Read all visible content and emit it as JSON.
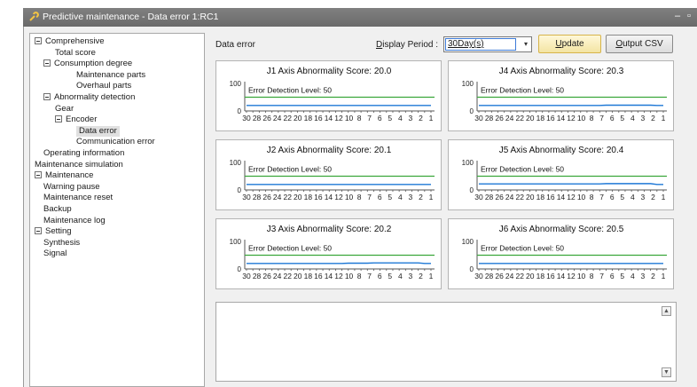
{
  "window": {
    "title": "Predictive maintenance - Data error 1:RC1",
    "app_icon": "wrench-icon",
    "minimize_glyph": "–",
    "restore_glyph": "▫"
  },
  "tree": {
    "items": [
      {
        "label": "Comprehensive",
        "level": 0,
        "expander": true
      },
      {
        "label": "Total score",
        "level": 2
      },
      {
        "label": "Consumption degree",
        "level": 1,
        "expander": true
      },
      {
        "label": "Maintenance parts",
        "level": 3
      },
      {
        "label": "Overhaul parts",
        "level": 3
      },
      {
        "label": "Abnormality detection",
        "level": 1,
        "expander": true
      },
      {
        "label": "Gear",
        "level": 2
      },
      {
        "label": "Encoder",
        "level": 2,
        "expander": true
      },
      {
        "label": "Data error",
        "level": 3,
        "selected": true
      },
      {
        "label": "Communication error",
        "level": 3
      },
      {
        "label": "Operating information",
        "level": 1
      },
      {
        "label": "Maintenance simulation",
        "level": 0
      },
      {
        "label": "Maintenance",
        "level": 0,
        "expander": true
      },
      {
        "label": "Warning pause",
        "level": 1
      },
      {
        "label": "Maintenance reset",
        "level": 1
      },
      {
        "label": "Backup",
        "level": 1
      },
      {
        "label": "Maintenance log",
        "level": 1
      },
      {
        "label": "Setting",
        "level": 0,
        "expander": true
      },
      {
        "label": "Synthesis",
        "level": 1
      },
      {
        "label": "Signal",
        "level": 1
      }
    ]
  },
  "toolbar": {
    "section_label": "Data error",
    "display_period_prefix": "D",
    "display_period_rest": "isplay Period :",
    "period_value": "30Day(s)",
    "update_label_ul": "U",
    "update_label_rest": "pdate",
    "output_label_ul": "O",
    "output_label_rest": "utput CSV"
  },
  "colors": {
    "threshold_line": "#3aa63a",
    "score_line": "#1e78d6",
    "axis": "#555555"
  },
  "chart_data": [
    {
      "type": "line",
      "title": "J1 Axis Abnormality Score: 20.0",
      "annotation": "Error Detection Level: 50",
      "ylim": [
        0,
        100
      ],
      "y_ticks": [
        "100",
        "0"
      ],
      "threshold": 50,
      "x_tick_labels": [
        "30",
        "28",
        "26",
        "24",
        "22",
        "20",
        "18",
        "16",
        "14",
        "12",
        "10",
        "8",
        "7",
        "6",
        "5",
        "4",
        "3",
        "2",
        "1"
      ],
      "series": [
        {
          "x": [
            30,
            29,
            28,
            27,
            26,
            25,
            24,
            23,
            22,
            21,
            20,
            19,
            18,
            17,
            16,
            15,
            14,
            13,
            12,
            11,
            10,
            9,
            8,
            7,
            6,
            5,
            4,
            3,
            2,
            1
          ],
          "values": [
            20,
            20,
            20,
            20,
            20,
            20,
            20,
            20,
            20,
            20,
            20,
            20,
            20,
            20,
            20,
            20,
            20,
            20,
            20,
            20,
            20,
            20,
            20,
            20,
            20,
            20,
            20,
            20,
            20,
            20
          ]
        }
      ]
    },
    {
      "type": "line",
      "title": "J4 Axis Abnormality Score: 20.3",
      "annotation": "Error Detection Level: 50",
      "ylim": [
        0,
        100
      ],
      "y_ticks": [
        "100",
        "0"
      ],
      "threshold": 50,
      "x_tick_labels": [
        "30",
        "28",
        "26",
        "24",
        "22",
        "20",
        "18",
        "16",
        "14",
        "12",
        "10",
        "8",
        "7",
        "6",
        "5",
        "4",
        "3",
        "2",
        "1"
      ],
      "series": [
        {
          "x": [
            30,
            29,
            28,
            27,
            26,
            25,
            24,
            23,
            22,
            21,
            20,
            19,
            18,
            17,
            16,
            15,
            14,
            13,
            12,
            11,
            10,
            9,
            8,
            7,
            6,
            5,
            4,
            3,
            2,
            1
          ],
          "values": [
            20,
            20,
            20,
            20,
            20,
            20,
            20,
            20,
            20,
            20,
            20,
            20,
            20,
            20,
            20,
            20,
            20,
            20,
            20,
            20,
            21,
            21,
            21,
            21,
            21,
            21,
            21,
            21,
            20,
            20
          ]
        }
      ]
    },
    {
      "type": "line",
      "title": "J2 Axis Abnormality Score: 20.1",
      "annotation": "Error Detection Level: 50",
      "ylim": [
        0,
        100
      ],
      "y_ticks": [
        "100",
        "0"
      ],
      "threshold": 50,
      "x_tick_labels": [
        "30",
        "28",
        "26",
        "24",
        "22",
        "20",
        "18",
        "16",
        "14",
        "12",
        "10",
        "8",
        "7",
        "6",
        "5",
        "4",
        "3",
        "2",
        "1"
      ],
      "series": [
        {
          "x": [
            30,
            29,
            28,
            27,
            26,
            25,
            24,
            23,
            22,
            21,
            20,
            19,
            18,
            17,
            16,
            15,
            14,
            13,
            12,
            11,
            10,
            9,
            8,
            7,
            6,
            5,
            4,
            3,
            2,
            1
          ],
          "values": [
            20,
            20,
            20,
            20,
            20,
            20,
            20,
            20,
            20,
            20,
            20,
            20,
            20,
            20,
            20,
            20,
            20,
            20,
            20,
            20,
            20,
            20,
            20,
            20,
            20,
            20,
            20,
            20,
            20,
            20
          ]
        }
      ]
    },
    {
      "type": "line",
      "title": "J5 Axis Abnormality Score: 20.4",
      "annotation": "Error Detection Level: 50",
      "ylim": [
        0,
        100
      ],
      "y_ticks": [
        "100",
        "0"
      ],
      "threshold": 50,
      "x_tick_labels": [
        "30",
        "28",
        "26",
        "24",
        "22",
        "20",
        "18",
        "16",
        "14",
        "12",
        "10",
        "8",
        "7",
        "6",
        "5",
        "4",
        "3",
        "2",
        "1"
      ],
      "series": [
        {
          "x": [
            30,
            29,
            28,
            27,
            26,
            25,
            24,
            23,
            22,
            21,
            20,
            19,
            18,
            17,
            16,
            15,
            14,
            13,
            12,
            11,
            10,
            9,
            8,
            7,
            6,
            5,
            4,
            3,
            2,
            1
          ],
          "values": [
            22,
            22,
            22,
            22,
            22,
            22,
            22,
            22,
            22,
            22,
            22,
            22,
            22,
            22,
            22,
            22,
            22,
            22,
            22,
            22,
            23,
            23,
            23,
            23,
            23,
            23,
            23,
            23,
            20,
            20
          ]
        }
      ]
    },
    {
      "type": "line",
      "title": "J3 Axis Abnormality Score: 20.2",
      "annotation": "Error Detection Level: 50",
      "ylim": [
        0,
        100
      ],
      "y_ticks": [
        "100",
        "0"
      ],
      "threshold": 50,
      "x_tick_labels": [
        "30",
        "28",
        "26",
        "24",
        "22",
        "20",
        "18",
        "16",
        "14",
        "12",
        "10",
        "8",
        "7",
        "6",
        "5",
        "4",
        "3",
        "2",
        "1"
      ],
      "series": [
        {
          "x": [
            30,
            29,
            28,
            27,
            26,
            25,
            24,
            23,
            22,
            21,
            20,
            19,
            18,
            17,
            16,
            15,
            14,
            13,
            12,
            11,
            10,
            9,
            8,
            7,
            6,
            5,
            4,
            3,
            2,
            1
          ],
          "values": [
            20,
            20,
            20,
            20,
            20,
            20,
            20,
            20,
            20,
            20,
            20,
            20,
            20,
            20,
            20,
            20,
            21,
            21,
            21,
            21,
            22,
            22,
            22,
            22,
            22,
            22,
            22,
            22,
            20,
            20
          ]
        }
      ]
    },
    {
      "type": "line",
      "title": "J6 Axis Abnormality Score: 20.5",
      "annotation": "Error Detection Level: 50",
      "ylim": [
        0,
        100
      ],
      "y_ticks": [
        "100",
        "0"
      ],
      "threshold": 50,
      "x_tick_labels": [
        "30",
        "28",
        "26",
        "24",
        "22",
        "20",
        "18",
        "16",
        "14",
        "12",
        "10",
        "8",
        "7",
        "6",
        "5",
        "4",
        "3",
        "2",
        "1"
      ],
      "series": [
        {
          "x": [
            30,
            29,
            28,
            27,
            26,
            25,
            24,
            23,
            22,
            21,
            20,
            19,
            18,
            17,
            16,
            15,
            14,
            13,
            12,
            11,
            10,
            9,
            8,
            7,
            6,
            5,
            4,
            3,
            2,
            1
          ],
          "values": [
            20,
            20,
            20,
            20,
            20,
            20,
            20,
            20,
            20,
            20,
            20,
            20,
            20,
            20,
            20,
            20,
            20,
            20,
            20,
            20,
            20,
            20,
            20,
            20,
            20,
            20,
            20,
            20,
            20,
            20
          ]
        }
      ]
    }
  ],
  "log": {
    "scroll_up_glyph": "▲",
    "scroll_down_glyph": "▼"
  }
}
